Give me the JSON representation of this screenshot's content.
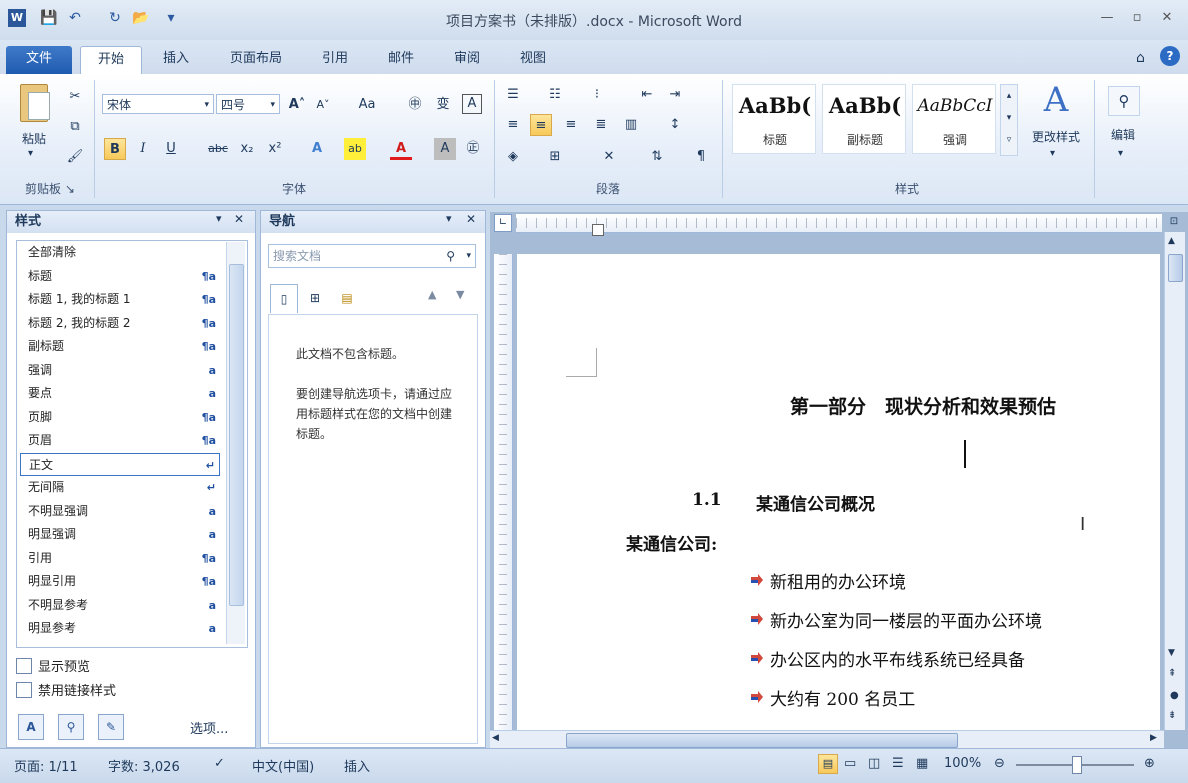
{
  "window": {
    "title": "项目方案书（未排版）.docx - Microsoft Word"
  },
  "quick_access": {
    "word": "W",
    "save": "💾",
    "undo": "↶",
    "redo": "↻",
    "open": "📂",
    "more": "▾"
  },
  "window_controls": {
    "minimize": "—",
    "restore": "▫",
    "close": "✕"
  },
  "tabs": [
    "文件",
    "开始",
    "插入",
    "页面布局",
    "引用",
    "邮件",
    "审阅",
    "视图"
  ],
  "ribbon": {
    "clipboard": {
      "paste": "粘贴",
      "group": "剪贴板"
    },
    "font": {
      "name": "宋体",
      "size": "四号",
      "group": "字体",
      "bold": "B",
      "italic": "I",
      "underline": "U",
      "strike": "abc",
      "sub": "x₂",
      "sup": "x²",
      "grow": "A˄",
      "shrink": "A˅",
      "case": "Aa",
      "pinyin": "㊥",
      "phonetic": "变",
      "border": "A",
      "effects": "A",
      "highlight": "ab",
      "color": "A",
      "shade": "A",
      "enclose": "㊣"
    },
    "paragraph": {
      "group": "段落"
    },
    "styles": {
      "group": "样式",
      "items": [
        {
          "sample": "AaBb(",
          "name": "标题"
        },
        {
          "sample": "AaBb(",
          "name": "副标题"
        },
        {
          "sample": "AaBbCcI",
          "name": "强调"
        }
      ],
      "change": "更改样式"
    },
    "editing": {
      "label": "编辑"
    }
  },
  "styles_pane": {
    "title": "样式",
    "items": [
      {
        "name": "全部清除",
        "mark": ""
      },
      {
        "name": "标题",
        "mark": "¶a"
      },
      {
        "name": "标题 1, 我的标题 1",
        "mark": "¶a"
      },
      {
        "name": "标题 2, 我的标题 2",
        "mark": "¶a"
      },
      {
        "name": "副标题",
        "mark": "¶a"
      },
      {
        "name": "强调",
        "mark": "a"
      },
      {
        "name": "要点",
        "mark": "a"
      },
      {
        "name": "页脚",
        "mark": "¶a"
      },
      {
        "name": "页眉",
        "mark": "¶a"
      },
      {
        "name": "正文",
        "mark": "↵"
      },
      {
        "name": "无间隔",
        "mark": "↵"
      },
      {
        "name": "不明显强调",
        "mark": "a"
      },
      {
        "name": "明显强调",
        "mark": "a"
      },
      {
        "name": "引用",
        "mark": "¶a"
      },
      {
        "name": "明显引用",
        "mark": "¶a"
      },
      {
        "name": "不明显参考",
        "mark": "a"
      },
      {
        "name": "明显参考",
        "mark": "a"
      }
    ],
    "show_preview": "显示预览",
    "disable_linked": "禁用链接样式",
    "options": "选项..."
  },
  "nav_pane": {
    "title": "导航",
    "search_placeholder": "搜索文档",
    "msg1": "此文档不包含标题。",
    "msg2": "要创建导航选项卡，请通过应用标题样式在您的文档中创建标题。"
  },
  "document": {
    "heading": "第一部分　现状分析和效果预估",
    "section_num": "1.1",
    "section_title": "某通信公司概况",
    "lead": "某通信公司:",
    "bullets": [
      "新租用的办公环境",
      "新办公室为同一楼层的平面办公环境",
      "办公区内的水平布线系统已经具备",
      "大约有 200 名员工"
    ]
  },
  "status": {
    "page": "页面: 1/11",
    "words": "字数: 3,026",
    "lang": "中文(中国)",
    "mode": "插入",
    "zoom": "100%"
  },
  "colors": {
    "accent": "#2b579a",
    "file_tab": "#2a63b7",
    "highlight": "#f8c95a"
  }
}
